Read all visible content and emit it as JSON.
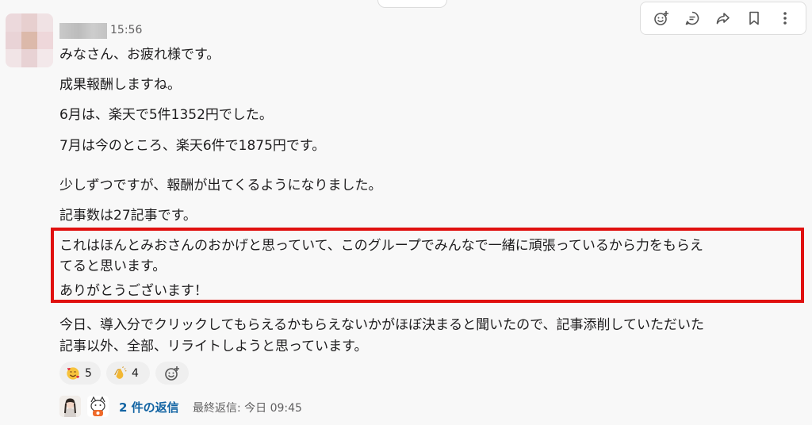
{
  "message": {
    "timestamp": "15:56",
    "lines": [
      "みなさん、お疲れ様です。",
      "成果報酬しますね。",
      "6月は、楽天で5件1352円でした。",
      "7月は今のところ、楽天6件で1875円です。",
      "少しずつですが、報酬が出てくるようになりました。",
      "記事数は27記事です。",
      "これはほんとみおさんのおかげと思っていて、このグループでみんなで一緒に頑張っているから力をもらえ",
      "てると思います。",
      "ありがとうございます！",
      "今日、導入分でクリックしてもらえるかもらえないかがほぼ決まると聞いたので、記事添削していただいた",
      "記事以外、全部、リライトしようと思っています。"
    ]
  },
  "toolbar": {
    "icons": [
      "add-reaction-icon",
      "reply-in-thread-icon",
      "share-icon",
      "bookmark-icon",
      "more-actions-icon"
    ]
  },
  "reactions": [
    {
      "icon": "smiling-face-with-hearts-icon",
      "count": "5"
    },
    {
      "icon": "clapping-hands-icon",
      "count": "4"
    }
  ],
  "thread": {
    "reply_count": "2 件の返信",
    "last_reply": "最終返信: 今日 09:45"
  },
  "colors": {
    "highlight_border": "#e0100f",
    "link": "#1264a3",
    "background": "#f8f8f8"
  }
}
